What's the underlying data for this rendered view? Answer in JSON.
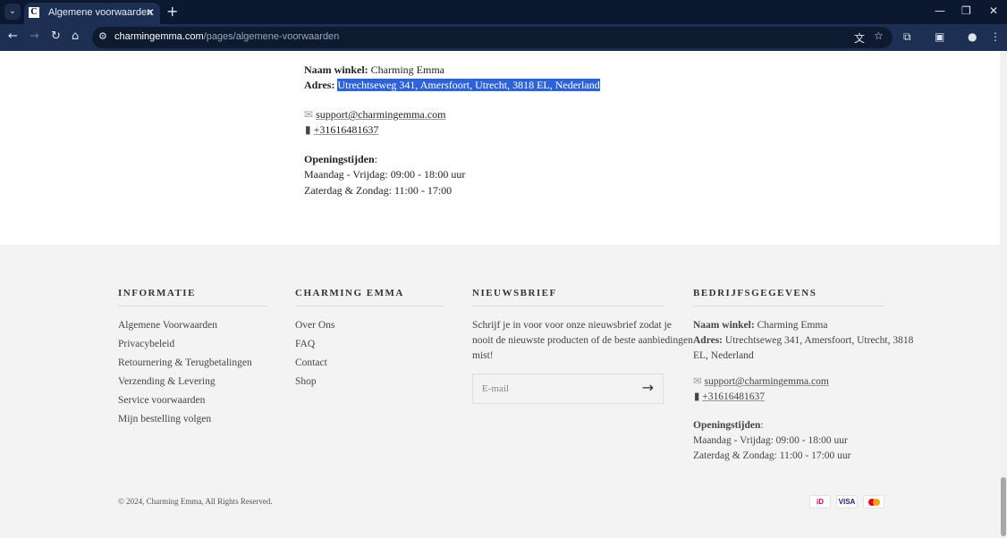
{
  "browser": {
    "tab_title": "Algemene voorwaarden",
    "url_domain": "charmingemma.com",
    "url_path": "/pages/algemene-voorwaarden"
  },
  "contact": {
    "name_label": "Naam winkel:",
    "name": "Charming Emma",
    "address_label": "Adres:",
    "address": "Utrechtseweg 341, Amersfoort, Utrecht, 3818 EL, Nederland",
    "email": "support@charmingemma.com",
    "phone": "+31616481637",
    "hours_label": "Openingstijden",
    "hours_weekday": "Maandag - Vrijdag: 09:00 - 18:00 uur",
    "hours_weekend": "Zaterdag & Zondag: 11:00 - 17:00"
  },
  "footer": {
    "info": {
      "heading": "INFORMATIE",
      "links": [
        "Algemene Voorwaarden",
        "Privacybeleid",
        "Retournering & Terugbetalingen",
        "Verzending & Levering",
        "Service voorwaarden",
        "Mijn bestelling volgen"
      ]
    },
    "brand": {
      "heading": "CHARMING EMMA",
      "links": [
        "Over Ons",
        "FAQ",
        "Contact",
        "Shop"
      ]
    },
    "newsletter": {
      "heading": "NIEUWSBRIEF",
      "text1": "Schrijf je in voor voor onze nieuwsbrief zodat je",
      "text2": "nooit de nieuwste producten of de beste aanbiedingen",
      "text3": "mist!",
      "placeholder": "E-mail"
    },
    "company": {
      "heading": "BEDRIJFSGEGEVENS",
      "name_label": "Naam winkel:",
      "name": "Charming Emma",
      "address_label": "Adres:",
      "address1": "Utrechtseweg 341, Amersfoort, Utrecht, 3818",
      "address2": "EL, Nederland",
      "email": "support@charmingemma.com",
      "phone": "+31616481637",
      "hours_label": "Openingstijden",
      "hours_weekday": "Maandag - Vrijdag: 09:00 - 18:00 uur",
      "hours_weekend": "Zaterdag & Zondag: 11:00 - 17:00 uur"
    },
    "copyright": "© 2024, Charming Emma, All Rights Reserved.",
    "payments": [
      "iDEAL",
      "VISA",
      "Mastercard"
    ]
  }
}
